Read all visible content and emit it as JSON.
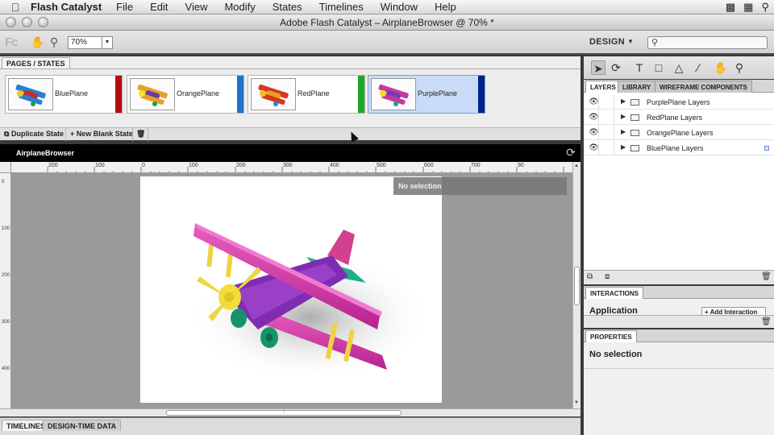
{
  "menubar": {
    "app_name": "Flash Catalyst",
    "items": [
      "File",
      "Edit",
      "View",
      "Modify",
      "States",
      "Timelines",
      "Window",
      "Help"
    ]
  },
  "window": {
    "title": "Adobe Flash Catalyst – AirplaneBrowser @ 70% *"
  },
  "toolbar": {
    "logo": "Fc",
    "zoom_value": "70%",
    "workspace": "DESIGN"
  },
  "pages": {
    "tab_label": "PAGES / STATES",
    "states": [
      {
        "label": "BluePlane",
        "color": "#b30d0d",
        "plane": "#2a7fd1"
      },
      {
        "label": "OrangePlane",
        "color": "#1f73c8",
        "plane": "#e89a22"
      },
      {
        "label": "RedPlane",
        "color": "#1fa52c",
        "plane": "#d43a1f"
      },
      {
        "label": "PurplePlane",
        "color": "#00228a",
        "plane": "#c63aa0"
      }
    ],
    "duplicate_label": "Duplicate State",
    "new_blank_label": "New Blank State"
  },
  "stage": {
    "title": "AirplaneBrowser",
    "no_selection": "No selection",
    "ruler_labels": [
      "200",
      "100",
      "0",
      "100",
      "200",
      "300",
      "400",
      "500",
      "600",
      "700",
      "90"
    ],
    "vruler_labels": [
      "0",
      "100",
      "200",
      "300",
      "400"
    ]
  },
  "bottom_tabs": [
    "TIMELINES",
    "DESIGN-TIME DATA"
  ],
  "layers": {
    "tabs": [
      "LAYERS",
      "LIBRARY",
      "WIREFRAME COMPONENTS"
    ],
    "items": [
      "PurplePlane Layers",
      "RedPlane Layers",
      "OrangePlane Layers",
      "BluePlane Layers"
    ]
  },
  "interactions": {
    "tab_label": "INTERACTIONS",
    "application": "Application",
    "add_label": "+ Add Interaction"
  },
  "properties": {
    "tab_label": "PROPERTIES",
    "selection": "No selection"
  }
}
